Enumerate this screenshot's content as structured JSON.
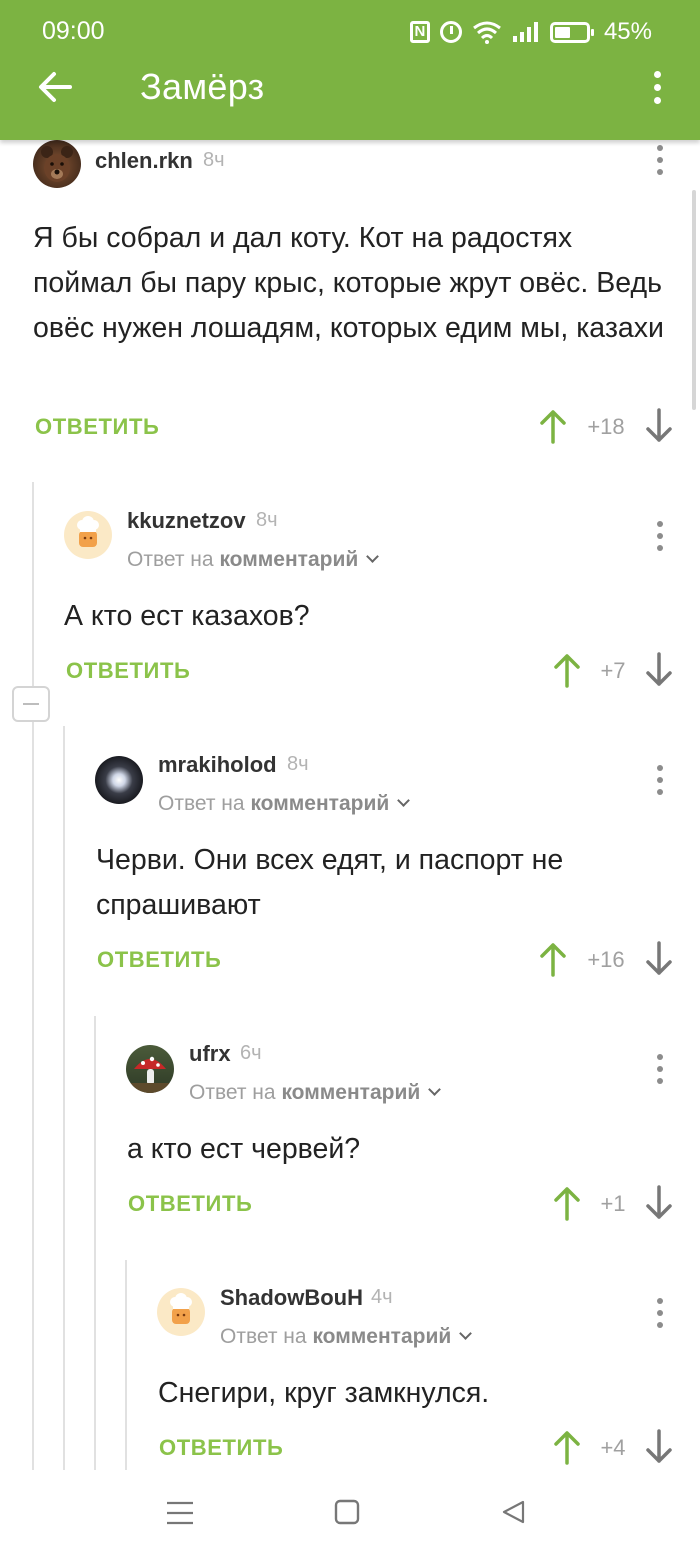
{
  "status_bar": {
    "time": "09:00",
    "battery_percent": "45%",
    "battery_level": 0.45,
    "icons": [
      "nfc-icon",
      "alarm-icon",
      "wifi-icon",
      "signal-icon",
      "battery-icon"
    ]
  },
  "app_bar": {
    "title": "Замёрз",
    "back_icon": "arrow-left-icon",
    "menu_icon": "more-vertical-icon",
    "color": "#7cb342"
  },
  "comments": [
    {
      "username": "chlen.rkn",
      "time_ago": "8ч",
      "reply_to": null,
      "text": "Я бы собрал и дал коту. Кот на радостях поймал бы пару крыс, которые жрут овёс. Ведь овёс нужен лошадям, которых едим мы, казахи",
      "reply_label": "ОТВЕТИТЬ",
      "rating": "+18",
      "avatar": "bear-avatar"
    },
    {
      "username": "kkuznetzov",
      "time_ago": "8ч",
      "reply_to": {
        "prefix": "Ответ на",
        "link": "комментарий"
      },
      "text": "А кто ест казахов?",
      "reply_label": "ОТВЕТИТЬ",
      "rating": "+7",
      "avatar": "default-chef-avatar"
    },
    {
      "username": "mrakiholod",
      "time_ago": "8ч",
      "reply_to": {
        "prefix": "Ответ на",
        "link": "комментарий"
      },
      "text": "Черви. Они всех едят, и паспорт не спрашивают",
      "reply_label": "ОТВЕТИТЬ",
      "rating": "+16",
      "avatar": "dark-orb-avatar"
    },
    {
      "username": "ufrx",
      "time_ago": "6ч",
      "reply_to": {
        "prefix": "Ответ на",
        "link": "комментарий"
      },
      "text": "а кто ест червей?",
      "reply_label": "ОТВЕТИТЬ",
      "rating": "+1",
      "avatar": "mushroom-avatar"
    },
    {
      "username": "ShadowBouH",
      "time_ago": "4ч",
      "reply_to": {
        "prefix": "Ответ на",
        "link": "комментарий"
      },
      "text": "Снегири, круг замкнулся.",
      "reply_label": "ОТВЕТИТЬ",
      "rating": "+4",
      "avatar": "default-chef-avatar"
    }
  ],
  "colors": {
    "accent": "#7cb342",
    "reply": "#8bc34a",
    "vote_up": "#7cb342",
    "vote_down": "#777777",
    "thread_line": "#e1e1e1"
  },
  "nav_bar": {
    "buttons": [
      "menu-lines-icon",
      "home-square-icon",
      "back-triangle-icon"
    ]
  }
}
